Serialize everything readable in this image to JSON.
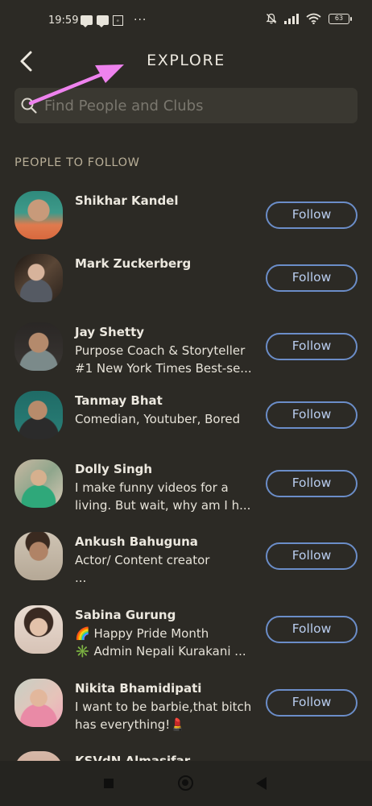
{
  "status_bar": {
    "time": "19:59",
    "sim_label": "ₑ",
    "more": "···",
    "battery": "63",
    "icons": [
      "message-icon",
      "message-icon",
      "sim-icon",
      "mute-icon",
      "signal-icon",
      "wifi-icon",
      "battery-icon"
    ]
  },
  "header": {
    "title": "EXPLORE",
    "back_icon": "chevron-left-icon"
  },
  "search": {
    "placeholder": "Find People and Clubs",
    "icon": "search-icon"
  },
  "annotation": {
    "color": "#ee82ee",
    "shape": "arrow"
  },
  "section": {
    "title": "PEOPLE TO FOLLOW"
  },
  "people": [
    {
      "name": "Shikhar Kandel",
      "bio": [
        "",
        ""
      ],
      "follow_label": "Follow"
    },
    {
      "name": "Mark Zuckerberg",
      "bio": [
        "",
        ""
      ],
      "follow_label": "Follow"
    },
    {
      "name": "Jay Shetty",
      "bio": [
        "Purpose Coach & Storyteller",
        "#1 New York Times Best-se..."
      ],
      "follow_label": "Follow"
    },
    {
      "name": "Tanmay Bhat",
      "bio": [
        "Comedian, Youtuber, Bored",
        ""
      ],
      "follow_label": "Follow"
    },
    {
      "name": "Dolly Singh",
      "bio": [
        "I make funny videos for a",
        "living. But wait, why am I h..."
      ],
      "follow_label": "Follow"
    },
    {
      "name": "Ankush Bahuguna",
      "bio": [
        "Actor/ Content creator",
        "..."
      ],
      "follow_label": "Follow"
    },
    {
      "name": "Sabina Gurung",
      "bio": [
        "🌈 Happy Pride Month",
        "✳️ Admin Nepali Kurakani ..."
      ],
      "follow_label": "Follow"
    },
    {
      "name": "Nikita Bhamidipati",
      "bio": [
        "I want to be barbie,that bitch",
        "has everything!💄"
      ],
      "follow_label": "Follow"
    },
    {
      "name": "KSVdN Almasifar",
      "bio": [
        "",
        ""
      ],
      "follow_label": ""
    }
  ],
  "colors": {
    "background": "#2c2a25",
    "accent_blue": "#6b8dc8",
    "section_gold": "#b8ae97",
    "search_bg": "#3a3831"
  },
  "nav_bar": {
    "icons": [
      "recents-square-icon",
      "home-circle-icon",
      "back-triangle-icon"
    ]
  }
}
